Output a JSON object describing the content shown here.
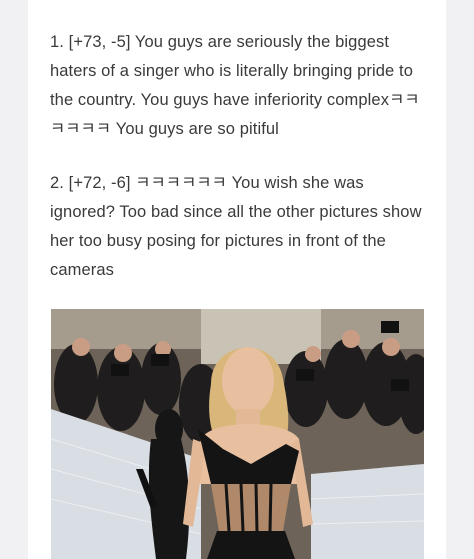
{
  "comments": [
    {
      "text": "1. [+73, -5] You guys are seriously the biggest haters of a singer who is literally bringing pride to the country. You guys have inferiority complexㅋㅋㅋㅋㅋㅋ You guys are so pitiful"
    },
    {
      "text": "2. [+72, -6] ㅋㅋㅋㅋㅋㅋ You wish she was ignored? Too bad since all the other pictures show her too busy posing for pictures in front of the cameras"
    }
  ],
  "photo": {
    "colors": {
      "background_crowd": "#2c2a2a",
      "stairs": "#d9dde4",
      "dress": "#141414",
      "hair": "#d9b77a",
      "skin": "#e8c0a0",
      "corset": "#b0896a"
    }
  }
}
